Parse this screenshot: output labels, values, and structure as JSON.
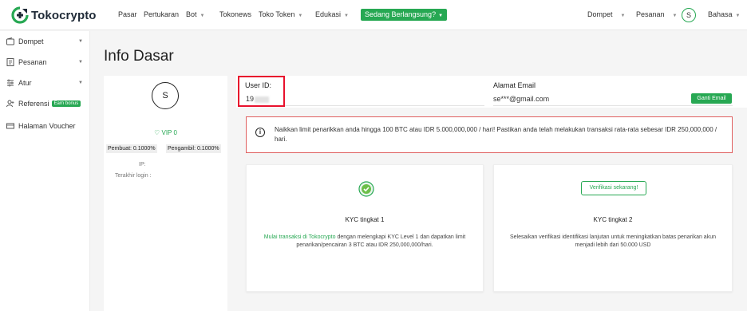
{
  "brand": {
    "name": "Tokocrypto",
    "accent": "#27a853",
    "alert_border": "#e06060",
    "highlight": "#e8112d"
  },
  "topnav": {
    "items": [
      {
        "label": "Pasar",
        "dropdown": false
      },
      {
        "label": "Pertukaran",
        "dropdown": false
      },
      {
        "label": "Bot",
        "dropdown": true
      },
      {
        "label": "Tokonews",
        "dropdown": false
      },
      {
        "label": "Toko Token",
        "dropdown": true
      },
      {
        "label": "Edukasi",
        "dropdown": true
      }
    ],
    "live_button": "Sedang Berlangsung?",
    "right": [
      {
        "label": "Dompet",
        "dropdown": true
      },
      {
        "label": "Pesanan",
        "dropdown": true
      }
    ],
    "avatar_letter": "S",
    "language": "Bahasa"
  },
  "sidebar": {
    "items": [
      {
        "label": "Dompet",
        "icon": "wallet-icon",
        "chevron": true
      },
      {
        "label": "Pesanan",
        "icon": "orders-icon",
        "chevron": true
      },
      {
        "label": "Atur",
        "icon": "settings-icon",
        "chevron": true
      },
      {
        "label": "Referensi",
        "icon": "referral-icon",
        "badge": "Earn bonus"
      },
      {
        "label": "Halaman Voucher",
        "icon": "voucher-icon"
      }
    ]
  },
  "page": {
    "title": "Info Dasar",
    "profile": {
      "avatar_letter": "S",
      "vip": "VIP 0",
      "maker_fee": "Pembuat: 0.1000%",
      "taker_fee": "Pengambil: 0.1000%",
      "ip_label": "IP:",
      "last_login_label": "Terakhir login :"
    },
    "user_id": {
      "label": "User ID:",
      "value": "19"
    },
    "email": {
      "label": "Alamat Email",
      "value": "se***@gmail.com",
      "button": "Ganti Email"
    },
    "alert": "Naikkan limit penarikkan anda hingga 100 BTC atau IDR 5.000,000,000 / hari! Pastikan anda telah melakukan transaksi rata-rata sebesar IDR 250,000,000 / hari.",
    "kyc": [
      {
        "title": "KYC tingkat 1",
        "link": "Mulai transaksi di Tokocrypto",
        "desc": " dengan melengkapi KYC Level 1 dan dapatkan limit penarikan/pencairan 3 BTC atau IDR 250,000,000/hari."
      },
      {
        "title": "KYC tingkat 2",
        "button": "Verifikasi sekarang!",
        "desc": "Selesaikan verifikasi identifikasi lanjutan untuk meningkatkan batas penarikan akun menjadi lebih dari 50.000 USD"
      }
    ]
  }
}
